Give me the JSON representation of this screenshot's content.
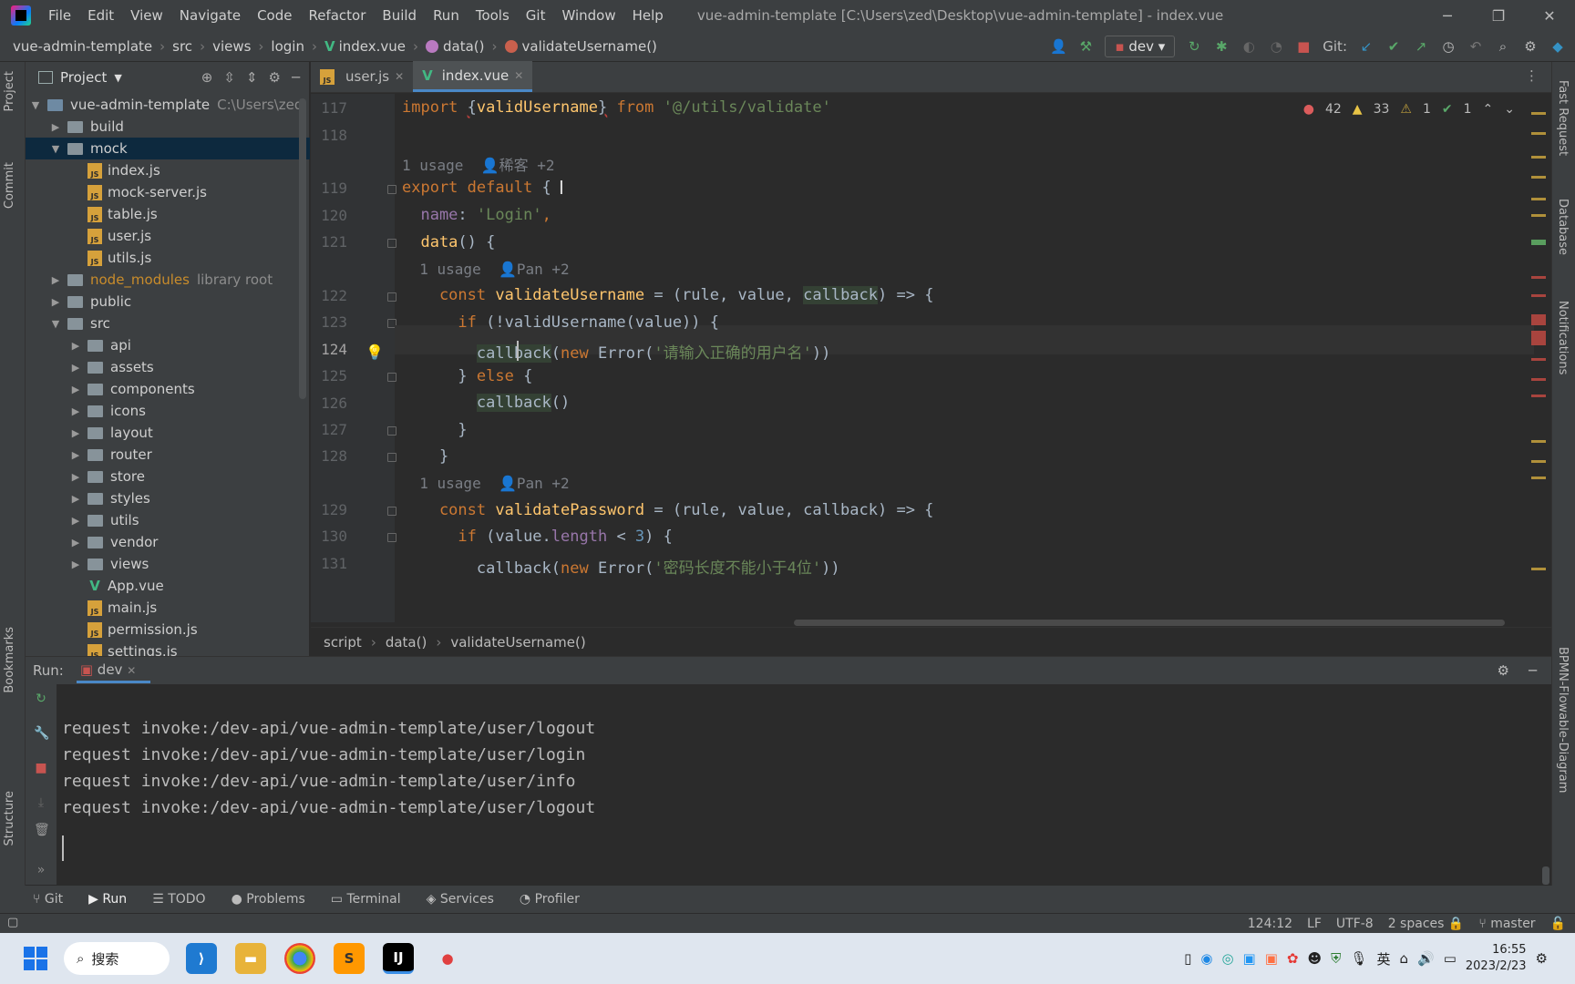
{
  "app": {
    "menu": [
      "File",
      "Edit",
      "View",
      "Navigate",
      "Code",
      "Refactor",
      "Build",
      "Run",
      "Tools",
      "Git",
      "Window",
      "Help"
    ],
    "window_title": "vue-admin-template [C:\\Users\\zed\\Desktop\\vue-admin-template] - index.vue"
  },
  "navbar": {
    "crumbs": [
      "vue-admin-template",
      "src",
      "views",
      "login",
      "index.vue",
      "data()",
      "validateUsername()"
    ],
    "run_config": "dev",
    "git_label": "Git:"
  },
  "project": {
    "title": "Project",
    "root": "vue-admin-template",
    "root_path": "C:\\Users\\zed",
    "items": [
      {
        "label": "build",
        "type": "folder",
        "depth": 1,
        "expanded": false
      },
      {
        "label": "mock",
        "type": "folder",
        "depth": 1,
        "expanded": true,
        "selected": true
      },
      {
        "label": "index.js",
        "type": "js",
        "depth": 2
      },
      {
        "label": "mock-server.js",
        "type": "js",
        "depth": 2
      },
      {
        "label": "table.js",
        "type": "js",
        "depth": 2
      },
      {
        "label": "user.js",
        "type": "js",
        "depth": 2
      },
      {
        "label": "utils.js",
        "type": "js",
        "depth": 2
      },
      {
        "label": "node_modules",
        "type": "folder",
        "depth": 1,
        "expanded": false,
        "note": "library root",
        "orange": true
      },
      {
        "label": "public",
        "type": "folder",
        "depth": 1,
        "expanded": false
      },
      {
        "label": "src",
        "type": "folder",
        "depth": 1,
        "expanded": true
      },
      {
        "label": "api",
        "type": "folder",
        "depth": 2,
        "expanded": false
      },
      {
        "label": "assets",
        "type": "folder",
        "depth": 2,
        "expanded": false
      },
      {
        "label": "components",
        "type": "folder",
        "depth": 2,
        "expanded": false
      },
      {
        "label": "icons",
        "type": "folder",
        "depth": 2,
        "expanded": false
      },
      {
        "label": "layout",
        "type": "folder",
        "depth": 2,
        "expanded": false
      },
      {
        "label": "router",
        "type": "folder",
        "depth": 2,
        "expanded": false
      },
      {
        "label": "store",
        "type": "folder",
        "depth": 2,
        "expanded": false
      },
      {
        "label": "styles",
        "type": "folder",
        "depth": 2,
        "expanded": false
      },
      {
        "label": "utils",
        "type": "folder",
        "depth": 2,
        "expanded": false
      },
      {
        "label": "vendor",
        "type": "folder",
        "depth": 2,
        "expanded": false
      },
      {
        "label": "views",
        "type": "folder",
        "depth": 2,
        "expanded": false
      },
      {
        "label": "App.vue",
        "type": "vue",
        "depth": 2
      },
      {
        "label": "main.js",
        "type": "js",
        "depth": 2
      },
      {
        "label": "permission.js",
        "type": "js",
        "depth": 2
      },
      {
        "label": "settings.js",
        "type": "js",
        "depth": 2
      }
    ]
  },
  "editor": {
    "tabs": [
      {
        "label": "user.js",
        "active": false
      },
      {
        "label": "index.vue",
        "active": true
      }
    ],
    "inspections": {
      "errors": "42",
      "warnings": "33",
      "weak": "1",
      "ok": "1"
    },
    "line_numbers": [
      "117",
      "118",
      "119",
      "120",
      "121",
      "122",
      "123",
      "124",
      "125",
      "126",
      "127",
      "128",
      "129",
      "130",
      "131"
    ],
    "current_line": "124",
    "hints": {
      "h119": "1 usage",
      "h119_author": "稀客 +2",
      "h122": "1 usage",
      "h122_author": "Pan +2",
      "h129": "1 usage",
      "h129_author": "Pan +2"
    },
    "lines": {
      "l117_kw": "import ",
      "l117_open": "{",
      "l117_name": "validUsername",
      "l117_close": "}",
      "l117_from": " from ",
      "l117_str": "'@/utils/validate'",
      "l119_kw": "export default ",
      "l119_br": "{",
      "l120_key": "  name",
      "l120_colon": ": ",
      "l120_str": "'Login'",
      "l120_comma": ",",
      "l121_fn": "  data",
      "l121_rest": "() {",
      "l122_kw": "    const ",
      "l122_name": "validateUsername",
      "l122_mid": " = (rule, value, ",
      "l122_cb": "callback",
      "l122_end": ") => {",
      "l123_kw": "      if ",
      "l123_rest": "(!validUsername(value)) {",
      "l124_pre": "        ",
      "l124_cb": "callback",
      "l124_p": "(",
      "l124_new": "new ",
      "l124_err": "Error",
      "l124_p2": "(",
      "l124_str": "'请输入正确的用户名'",
      "l124_end": "))",
      "l125_a": "      } ",
      "l125_kw": "else",
      "l125_b": " {",
      "l126_pre": "        ",
      "l126_cb": "callback",
      "l126_end": "()",
      "l127": "      }",
      "l128": "    }",
      "l129_kw": "    const ",
      "l129_name": "validatePassword",
      "l129_end": " = (rule, value, callback) => {",
      "l130_kw": "      if ",
      "l130_a": "(value.",
      "l130_prop": "length",
      "l130_b": " < ",
      "l130_num": "3",
      "l130_c": ") {",
      "l131_pre": "        callback(",
      "l131_new": "new ",
      "l131_err": "Error",
      "l131_p": "(",
      "l131_str": "'密码长度不能小于4位'",
      "l131_end": "))"
    },
    "breadcrumb": [
      "script",
      "data()",
      "validateUsername()"
    ]
  },
  "run": {
    "label": "Run:",
    "tab": "dev",
    "console": [
      "request invoke:/dev-api/vue-admin-template/user/logout",
      "request invoke:/dev-api/vue-admin-template/user/login",
      "request invoke:/dev-api/vue-admin-template/user/info",
      "request invoke:/dev-api/vue-admin-template/user/logout"
    ]
  },
  "side_tabs": {
    "left": [
      "Project",
      "Commit",
      "Bookmarks",
      "Structure"
    ],
    "right": [
      "Fast Request",
      "Database",
      "Notifications",
      "BPMN-Flowable-Diagram"
    ]
  },
  "bottom_tabs": [
    "Git",
    "Run",
    "TODO",
    "Problems",
    "Terminal",
    "Services",
    "Profiler"
  ],
  "status": {
    "position": "124:12",
    "line_sep": "LF",
    "encoding": "UTF-8",
    "indent": "2 spaces",
    "branch": "master"
  },
  "taskbar": {
    "search": "搜索",
    "ime": "英",
    "time": "16:55",
    "date": "2023/2/23"
  },
  "colors": {
    "accent": "#4a88c7",
    "vue": "#42b883",
    "keyword": "#cc7832",
    "string": "#6a8759"
  }
}
